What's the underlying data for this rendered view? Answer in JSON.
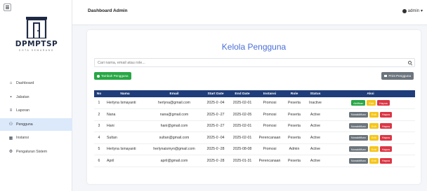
{
  "sidebar": {
    "logo_text": "DPMPTSP",
    "logo_subtext": "KOTA SEMARANG",
    "items": [
      {
        "label": "Dashboard",
        "icon": "home-icon",
        "glyph": "⌂",
        "active": false
      },
      {
        "label": "Jabatan",
        "icon": "briefcase-icon",
        "glyph": "▪",
        "active": false
      },
      {
        "label": "Laporan",
        "icon": "report-icon",
        "glyph": "≡",
        "active": false
      },
      {
        "label": "Pengguna",
        "icon": "users-icon",
        "glyph": "⚇",
        "active": true
      },
      {
        "label": "Instansi",
        "icon": "building-icon",
        "glyph": "▦",
        "active": false
      },
      {
        "label": "Pengaturan Sistem",
        "icon": "settings-icon",
        "glyph": "⚙",
        "active": false
      }
    ]
  },
  "topbar": {
    "title": "Dashboard Admin",
    "user": "admin"
  },
  "main": {
    "title": "Kelola Pengguna",
    "search_placeholder": "Cari nama, email atau role...",
    "add_button": "Tambah Pengguna",
    "print_button": "Print Pengguna"
  },
  "table": {
    "headers": [
      "No",
      "Nama",
      "Email",
      "Start Date",
      "End Date",
      "Instansi",
      "Role",
      "Status",
      "Aksi"
    ],
    "rows": [
      {
        "no": "1",
        "nama": "Herlyna Ismayanti",
        "email": "herlyna@gmail.com",
        "start": "2025-0 -04",
        "end": "2025-02-01",
        "instansi": "Promosi",
        "role": "Peserta",
        "status": "Inactive",
        "toggle": "Aktifkan",
        "toggle_on": true
      },
      {
        "no": "2",
        "nama": "Nana",
        "email": "nana@gmail.com",
        "start": "2025-0 -27",
        "end": "2025-02-05",
        "instansi": "Promosi",
        "role": "Peserta",
        "status": "Active",
        "toggle": "Nonaktifkan",
        "toggle_on": false
      },
      {
        "no": "3",
        "nama": "Hani",
        "email": "hani@gmail.com",
        "start": "2025-0 -27",
        "end": "2025-02-01",
        "instansi": "Promosi",
        "role": "Peserta",
        "status": "Active",
        "toggle": "Nonaktifkan",
        "toggle_on": false
      },
      {
        "no": "4",
        "nama": "Sultan",
        "email": "sultan@gmail.com",
        "start": "2025-0 -04",
        "end": "2025-02-01",
        "instansi": "Perencanaan",
        "role": "Peserta",
        "status": "Active",
        "toggle": "Nonaktifkan",
        "toggle_on": false
      },
      {
        "no": "5",
        "nama": "Herlyna Ismayanti",
        "email": "herlynaismyn@gmail.com",
        "start": "2025-0 -28",
        "end": "2025-08-08",
        "instansi": "Promosi",
        "role": "Admin",
        "status": "Active",
        "toggle": "Nonaktifkan",
        "toggle_on": false
      },
      {
        "no": "6",
        "nama": "April",
        "email": "april@gmail.com",
        "start": "2025-0 -28",
        "end": "2025-01-31",
        "instansi": "Perencanaan",
        "role": "Peserta",
        "status": "Active",
        "toggle": "Nonaktifkan",
        "toggle_on": false
      }
    ],
    "edit_label": "Edit",
    "delete_label": "Hapus"
  },
  "colors": {
    "accent": "#4a6fd8",
    "header": "#1f3d7a",
    "success": "#28a745",
    "warning": "#f5c518",
    "danger": "#dc3545",
    "secondary": "#6c757d"
  }
}
